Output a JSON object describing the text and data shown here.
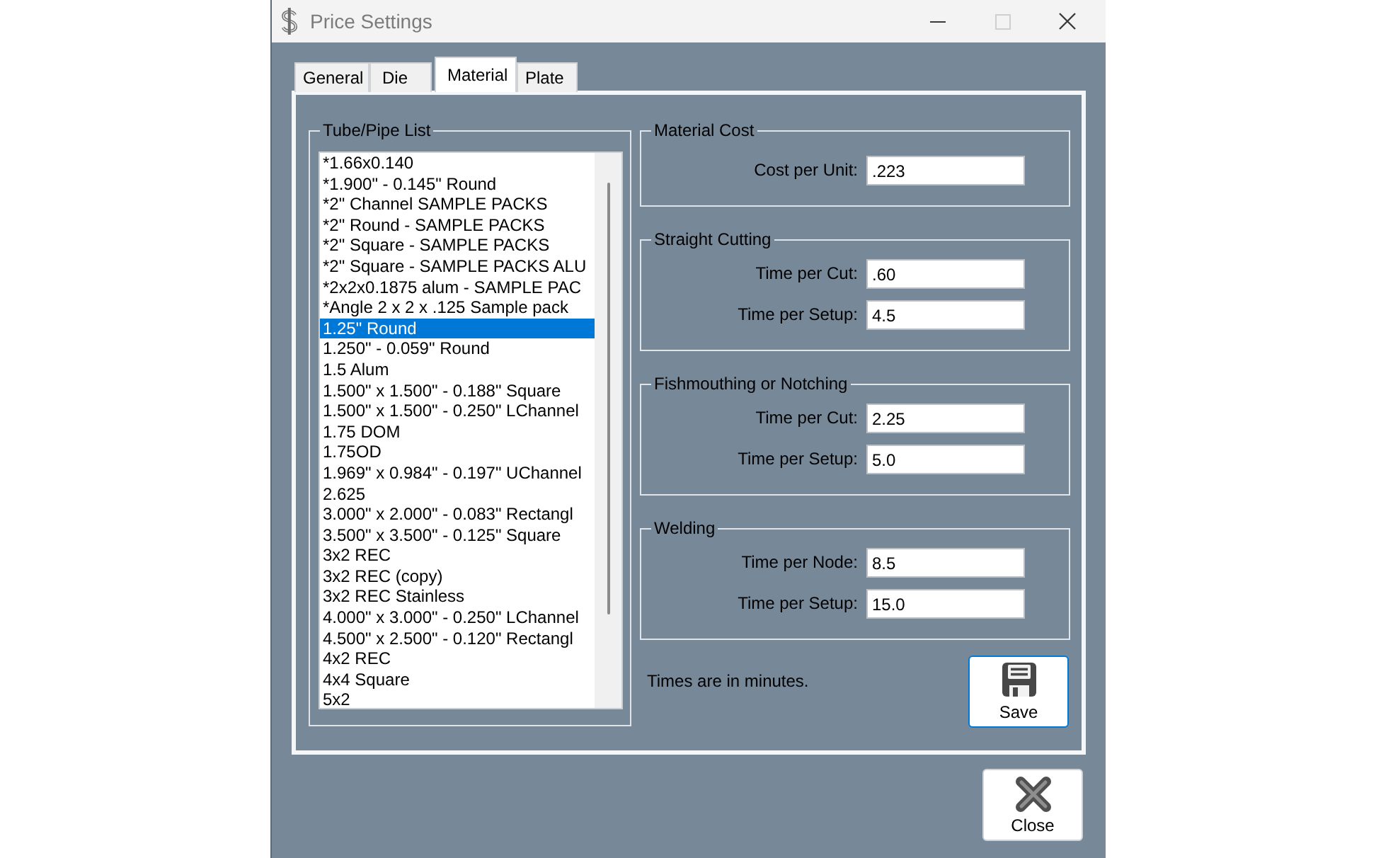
{
  "window": {
    "title": "Price Settings",
    "controls": [
      {
        "kind": "minimize",
        "disabled": false
      },
      {
        "kind": "maximize",
        "disabled": true
      },
      {
        "kind": "close",
        "disabled": false
      }
    ]
  },
  "tabs": [
    {
      "label": "General",
      "selected": false
    },
    {
      "label": "Die",
      "selected": false
    },
    {
      "label": "Material",
      "selected": true
    },
    {
      "label": "Plate",
      "selected": false
    }
  ],
  "tube_pipe_list": {
    "title": "Tube/Pipe List",
    "items": [
      {
        "label": "*1.66x0.140",
        "selected": false
      },
      {
        "label": "*1.900\" - 0.145\" Round",
        "selected": false
      },
      {
        "label": "*2\" Channel SAMPLE PACKS",
        "selected": false
      },
      {
        "label": "*2\" Round - SAMPLE PACKS",
        "selected": false
      },
      {
        "label": "*2\" Square - SAMPLE PACKS",
        "selected": false
      },
      {
        "label": "*2\" Square - SAMPLE PACKS ALU",
        "selected": false
      },
      {
        "label": "*2x2x0.1875 alum - SAMPLE PAC",
        "selected": false
      },
      {
        "label": "*Angle 2 x 2 x .125 Sample pack",
        "selected": false
      },
      {
        "label": "1.25\" Round",
        "selected": true
      },
      {
        "label": "1.250\" - 0.059\" Round",
        "selected": false
      },
      {
        "label": "1.5 Alum",
        "selected": false
      },
      {
        "label": "1.500\" x 1.500\" - 0.188\" Square",
        "selected": false
      },
      {
        "label": "1.500\" x 1.500\" - 0.250\" LChannel",
        "selected": false
      },
      {
        "label": "1.75 DOM",
        "selected": false
      },
      {
        "label": "1.75OD",
        "selected": false
      },
      {
        "label": "1.969\" x 0.984\" - 0.197\" UChannel",
        "selected": false
      },
      {
        "label": "2.625",
        "selected": false
      },
      {
        "label": "3.000\" x 2.000\" - 0.083\" Rectangl",
        "selected": false
      },
      {
        "label": "3.500\" x 3.500\" - 0.125\" Square",
        "selected": false
      },
      {
        "label": "3x2 REC",
        "selected": false
      },
      {
        "label": "3x2 REC (copy)",
        "selected": false
      },
      {
        "label": "3x2 REC Stainless",
        "selected": false
      },
      {
        "label": "4.000\" x 3.000\" - 0.250\" LChannel",
        "selected": false
      },
      {
        "label": "4.500\" x 2.500\" - 0.120\" Rectangl",
        "selected": false
      },
      {
        "label": "4x2 REC",
        "selected": false
      },
      {
        "label": "4x4 Square",
        "selected": false
      },
      {
        "label": "5x2",
        "selected": false
      }
    ]
  },
  "groups": [
    {
      "title": "Material Cost",
      "fields": [
        {
          "label": "Cost per Unit:",
          "value": ".223"
        }
      ]
    },
    {
      "title": "Straight Cutting",
      "fields": [
        {
          "label": "Time per Cut:",
          "value": ".60"
        },
        {
          "label": "Time per Setup:",
          "value": "4.5"
        }
      ]
    },
    {
      "title": "Fishmouthing or Notching",
      "fields": [
        {
          "label": "Time per Cut:",
          "value": "2.25"
        },
        {
          "label": "Time per Setup:",
          "value": "5.0"
        }
      ]
    },
    {
      "title": "Welding",
      "fields": [
        {
          "label": "Time per Node:",
          "value": "8.5"
        },
        {
          "label": "Time per Setup:",
          "value": "15.0"
        }
      ]
    }
  ],
  "note": "Times are in minutes.",
  "save_button": {
    "label": "Save"
  },
  "close_button": {
    "label": "Close"
  }
}
